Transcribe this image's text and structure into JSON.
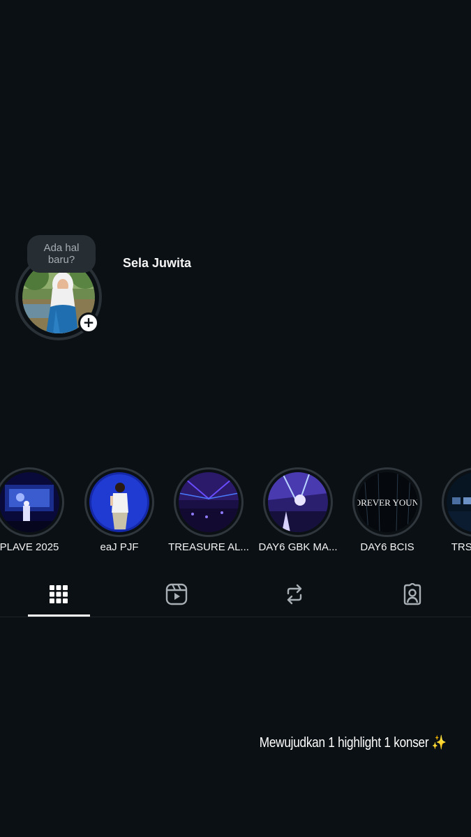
{
  "profile": {
    "note": "Ada hal baru?",
    "name": "Sela Juwita",
    "add_story_symbol": "+"
  },
  "highlights": [
    {
      "label": "PLAVE 2025"
    },
    {
      "label": "eaJ PJF"
    },
    {
      "label": "TREASURE AL..."
    },
    {
      "label": "DAY6 GBK MA..."
    },
    {
      "label": "DAY6 BCIS"
    },
    {
      "label": "TRSR IN..."
    }
  ],
  "tabs": [
    {
      "icon": "grid-icon",
      "selected": true
    },
    {
      "icon": "reels-icon",
      "selected": false
    },
    {
      "icon": "repost-icon",
      "selected": false
    },
    {
      "icon": "tagged-icon",
      "selected": false
    }
  ],
  "caption": "Mewujudkan 1 highlight 1 konser ✨",
  "colors": {
    "background": "#0b1014",
    "note_bubble": "#262d33",
    "ring": "#2f363c",
    "text": "#ffffff"
  }
}
